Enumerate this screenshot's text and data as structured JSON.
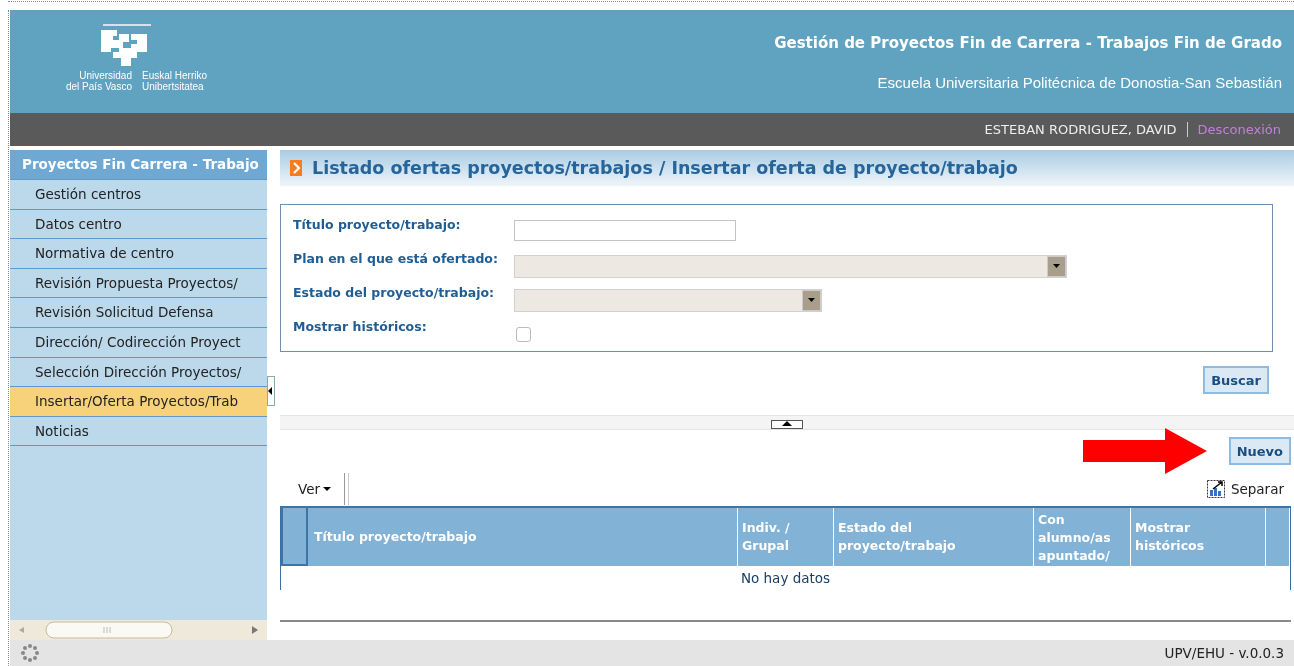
{
  "header": {
    "logo_spanish": [
      "Universidad",
      "del País Vasco"
    ],
    "logo_basque": [
      "Euskal Herriko",
      "Unibertsitatea"
    ],
    "title": "Gestión de Proyectos Fin de Carrera - Trabajos Fin de Grado",
    "subtitle": "Escuela Universitaria Politécnica de Donostia-San Sebastián"
  },
  "user_bar": {
    "user": "ESTEBAN RODRIGUEZ, DAVID",
    "logout": "Desconexión"
  },
  "sidebar": {
    "title": "Proyectos Fin Carrera - Trabajo",
    "items": [
      {
        "label": "Gestión centros",
        "selected": false
      },
      {
        "label": "Datos centro",
        "selected": false
      },
      {
        "label": "Normativa de centro",
        "selected": false
      },
      {
        "label": "Revisión Propuesta Proyectos/",
        "selected": false
      },
      {
        "label": "Revisión Solicitud Defensa",
        "selected": false
      },
      {
        "label": "Dirección/ Codirección Proyect",
        "selected": false
      },
      {
        "label": "Selección Dirección Proyectos/",
        "selected": false
      },
      {
        "label": "Insertar/Oferta Proyectos/Trab",
        "selected": true
      },
      {
        "label": "Noticias",
        "selected": false
      }
    ]
  },
  "page_title": "Listado ofertas proyectos/trabajos / Insertar oferta de proyecto/trabajo",
  "form": {
    "fields": [
      {
        "kind": "text",
        "label": "Título proyecto/trabajo:"
      },
      {
        "kind": "select",
        "label": "Plan en el que está ofertado:",
        "disabled": true
      },
      {
        "kind": "select",
        "label": "Estado del proyecto/trabajo:",
        "disabled": true
      },
      {
        "kind": "checkbox",
        "label": "Mostrar históricos:",
        "checked": false
      }
    ],
    "search_button": "Buscar"
  },
  "new_button": "Nuevo",
  "toolbar": {
    "view_menu": "Ver",
    "detach": "Separar"
  },
  "table": {
    "columns": [
      "Título proyecto/trabajo",
      "Indiv. / Grupal",
      "Estado del proyecto/trabajo",
      "Con alumno/as apuntado/",
      "Mostrar históricos"
    ],
    "empty_message": "No hay datos"
  },
  "footer": {
    "version": "UPV/EHU - v.0.0.3"
  }
}
